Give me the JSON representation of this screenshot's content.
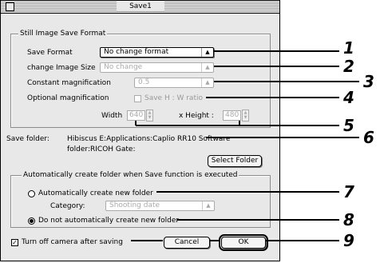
{
  "window": {
    "title": "Save1"
  },
  "still_image_group": {
    "legend": "Still Image Save Format",
    "save_format": {
      "label": "Save Format",
      "value": "No change format"
    },
    "image_size": {
      "label": "change Image Size",
      "value": "No change"
    },
    "constant_magnification": {
      "label": "Constant magnification",
      "value": "0.5"
    },
    "optional_magnification": {
      "label": "Optional magnification",
      "checkbox_label": "Save H : W ratio",
      "width_label": "Width",
      "width_value": "640",
      "height_label": "x Height :",
      "height_value": "480"
    }
  },
  "save_folder": {
    "label": "Save folder:",
    "path_line1": "Hibiscus E:Applications:Caplio RR10 Software",
    "path_line2": "folder:RICOH Gate:",
    "select_button": "Select Folder"
  },
  "auto_folder_group": {
    "legend": "Automatically create folder when Save function is executed",
    "auto_create_label": "Automatically create new folder",
    "category_label": "Category:",
    "category_value": "Shooting date",
    "no_auto_create_label": "Do not automatically create new folder"
  },
  "footer": {
    "turn_off_label": "Turn off camera after saving",
    "turn_off_checked": true,
    "cancel": "Cancel",
    "ok": "OK"
  },
  "callouts": [
    "1",
    "2",
    "3",
    "4",
    "5",
    "6",
    "7",
    "8",
    "9"
  ]
}
